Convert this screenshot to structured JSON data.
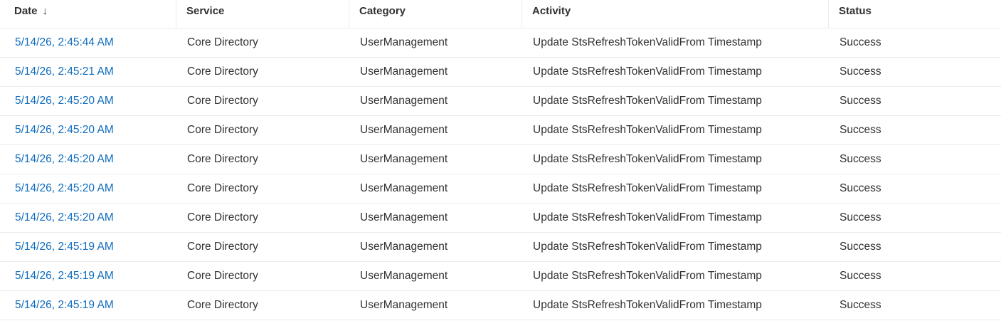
{
  "table": {
    "columns": [
      {
        "key": "date",
        "label": "Date",
        "sorted": "descending"
      },
      {
        "key": "service",
        "label": "Service"
      },
      {
        "key": "category",
        "label": "Category"
      },
      {
        "key": "activity",
        "label": "Activity"
      },
      {
        "key": "status",
        "label": "Status"
      }
    ],
    "sort_icon": "arrow-down-icon",
    "sort_glyph": "↓",
    "rows": [
      {
        "date": "5/14/26, 2:45:44 AM",
        "service": "Core Directory",
        "category": "UserManagement",
        "activity": "Update StsRefreshTokenValidFrom Timestamp",
        "status": "Success"
      },
      {
        "date": "5/14/26, 2:45:21 AM",
        "service": "Core Directory",
        "category": "UserManagement",
        "activity": "Update StsRefreshTokenValidFrom Timestamp",
        "status": "Success"
      },
      {
        "date": "5/14/26, 2:45:20 AM",
        "service": "Core Directory",
        "category": "UserManagement",
        "activity": "Update StsRefreshTokenValidFrom Timestamp",
        "status": "Success"
      },
      {
        "date": "5/14/26, 2:45:20 AM",
        "service": "Core Directory",
        "category": "UserManagement",
        "activity": "Update StsRefreshTokenValidFrom Timestamp",
        "status": "Success"
      },
      {
        "date": "5/14/26, 2:45:20 AM",
        "service": "Core Directory",
        "category": "UserManagement",
        "activity": "Update StsRefreshTokenValidFrom Timestamp",
        "status": "Success"
      },
      {
        "date": "5/14/26, 2:45:20 AM",
        "service": "Core Directory",
        "category": "UserManagement",
        "activity": "Update StsRefreshTokenValidFrom Timestamp",
        "status": "Success"
      },
      {
        "date": "5/14/26, 2:45:20 AM",
        "service": "Core Directory",
        "category": "UserManagement",
        "activity": "Update StsRefreshTokenValidFrom Timestamp",
        "status": "Success"
      },
      {
        "date": "5/14/26, 2:45:19 AM",
        "service": "Core Directory",
        "category": "UserManagement",
        "activity": "Update StsRefreshTokenValidFrom Timestamp",
        "status": "Success"
      },
      {
        "date": "5/14/26, 2:45:19 AM",
        "service": "Core Directory",
        "category": "UserManagement",
        "activity": "Update StsRefreshTokenValidFrom Timestamp",
        "status": "Success"
      },
      {
        "date": "5/14/26, 2:45:19 AM",
        "service": "Core Directory",
        "category": "UserManagement",
        "activity": "Update StsRefreshTokenValidFrom Timestamp",
        "status": "Success"
      }
    ]
  },
  "colors": {
    "link": "#0f6cbd",
    "text": "#323130",
    "divider": "#edebe9"
  }
}
